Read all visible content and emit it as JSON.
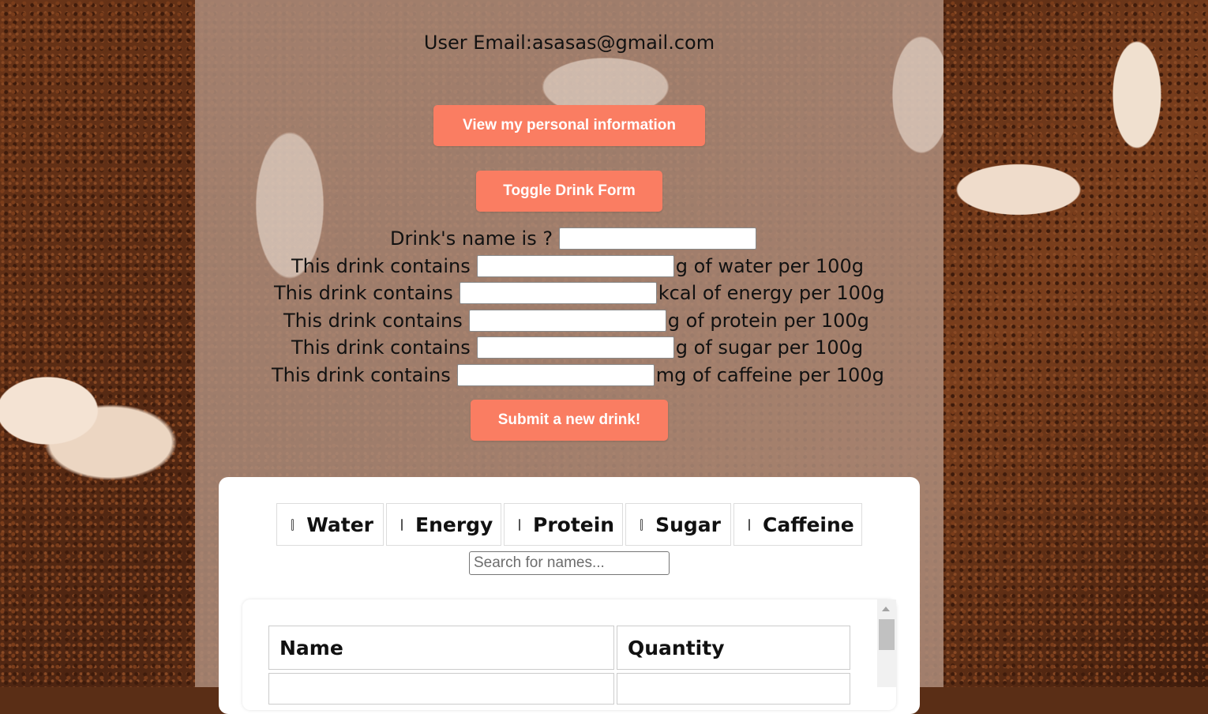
{
  "user": {
    "email_label": "User Email:asasas@gmail.com"
  },
  "buttons": {
    "view_info": "View my personal information",
    "toggle_form": "Toggle Drink Form",
    "submit_drink": "Submit a new drink!"
  },
  "form": {
    "name_label": "Drink's name is ?",
    "rows": [
      {
        "prefix": "This drink contains",
        "suffix": "g of water per 100g",
        "value": ""
      },
      {
        "prefix": "This drink contains",
        "suffix": "kcal of energy per 100g",
        "value": ""
      },
      {
        "prefix": "This drink contains",
        "suffix": "g of protein per 100g",
        "value": ""
      },
      {
        "prefix": "This drink contains",
        "suffix": "g of sugar per 100g",
        "value": ""
      },
      {
        "prefix": "This drink contains",
        "suffix": "mg of caffeine per 100g",
        "value": ""
      }
    ]
  },
  "filters": [
    {
      "label": "Water",
      "checked": false
    },
    {
      "label": "Energy",
      "checked": false
    },
    {
      "label": "Protein",
      "checked": false
    },
    {
      "label": "Sugar",
      "checked": false
    },
    {
      "label": "Caffeine",
      "checked": false
    }
  ],
  "search": {
    "placeholder": "Search for names...",
    "value": ""
  },
  "table": {
    "headers": [
      "Name",
      "Quantity"
    ]
  },
  "colors": {
    "accent": "#fa7d62"
  }
}
